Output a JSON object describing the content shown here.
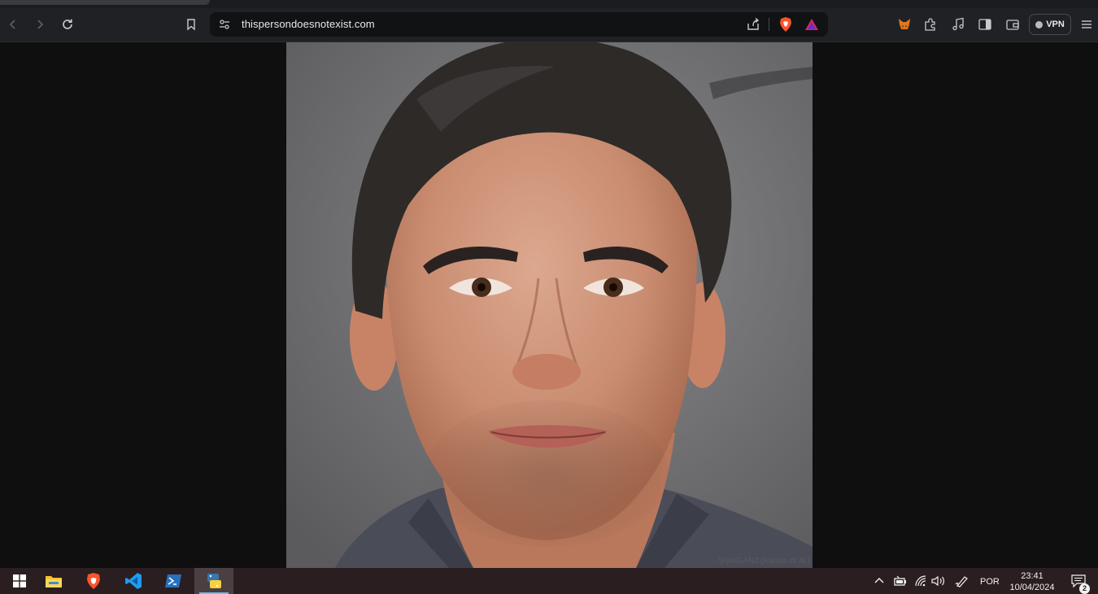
{
  "browser": {
    "url": "thispersondoesnotexist.com",
    "vpn_label": "VPN"
  },
  "page": {
    "image_credit": "StyleGAN2 (Karras et al.)"
  },
  "taskbar": {
    "language": "POR",
    "time": "23:41",
    "date": "10/04/2024",
    "notification_count": "2"
  },
  "colors": {
    "browser_toolbar": "#202125",
    "page_background": "#0f0f10",
    "taskbar": "#2a1e20",
    "brave_orange": "#fb542b"
  }
}
